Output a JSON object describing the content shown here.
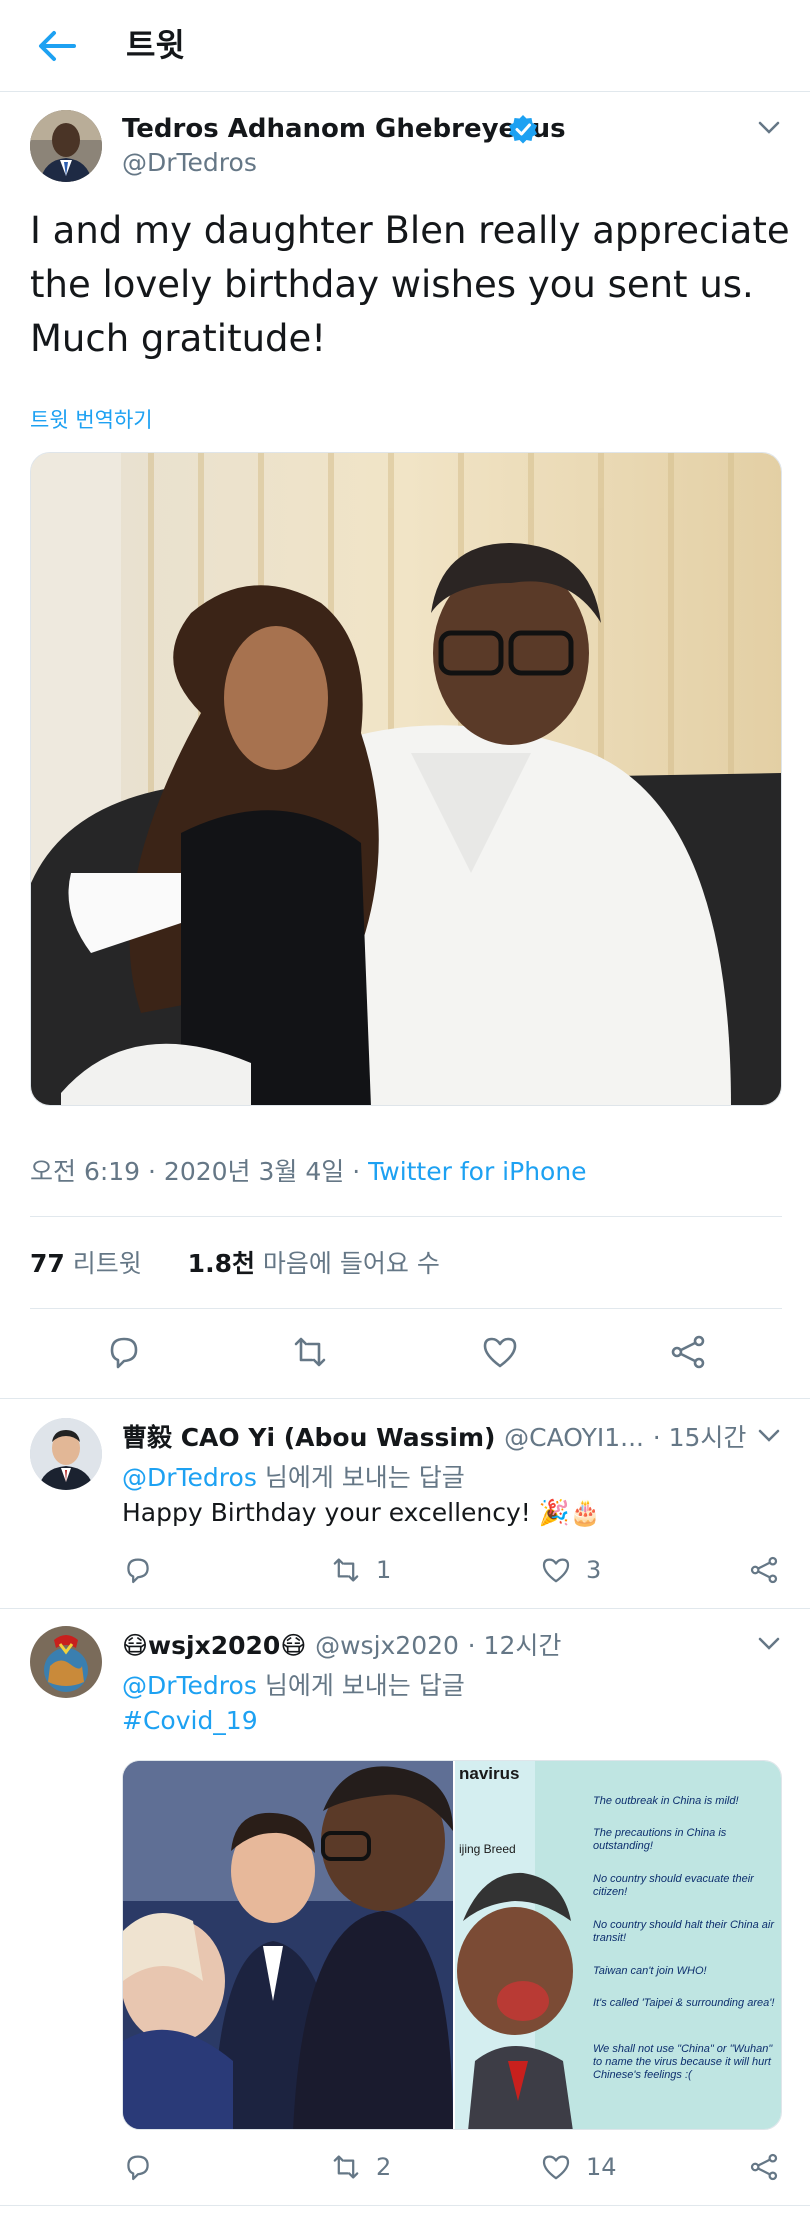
{
  "header": {
    "title": "트윗"
  },
  "tweet": {
    "author_name": "Tedros Adhanom Ghebreyesus",
    "author_handle": "@DrTedros",
    "text": "I and my daughter Blen really appreciate the lovely birthday wishes you sent us. Much gratitude!",
    "translate_label": "트윗 번역하기",
    "time": "오전 6:19 · 2020년 3월 4일 ·",
    "source": "Twitter for iPhone",
    "retweet_count": "77",
    "retweet_label": "리트윗",
    "like_count": "1.8천",
    "like_label": "마음에 들어요 수"
  },
  "replies": [
    {
      "name": "曹毅 CAO Yi (Abou Wassim)",
      "handle": "@CAOYI1...",
      "time": "· 15시간",
      "reply_to_handle": "@DrTedros",
      "reply_to_suffix": "님에게 보내는 답글",
      "text": "Happy Birthday your excellency! 🎉🎂",
      "retweets": "1",
      "likes": "3"
    },
    {
      "name": "😷wsjx2020😷",
      "handle": "@wsjx2020",
      "time": "· 12시간",
      "reply_to_handle": "@DrTedros",
      "reply_to_suffix": "님에게 보내는 답글",
      "hashtag": "#Covid_19",
      "retweets": "2",
      "likes": "14",
      "cartoon": {
        "title_fragment": "navirus",
        "left_label": "ijing Breed",
        "bullets": [
          "The outbreak in China is mild!",
          "The precautions in China is outstanding!",
          "No country should evacuate their citizen!",
          "No country should halt their China air transit!",
          "Taiwan can't join WHO!",
          "It's called 'Taipei & surrounding area'!",
          "We shall not use \"China\" or \"Wuhan\" to name the virus because it will hurt Chinese's feelings :("
        ]
      }
    }
  ],
  "colors": {
    "accent": "#1da1f2",
    "text": "#14171a",
    "muted": "#657786",
    "divider": "#e1e8ed"
  },
  "icons": [
    "back-arrow-icon",
    "verified-badge-icon",
    "chevron-down-icon",
    "reply-icon",
    "retweet-icon",
    "like-icon",
    "share-icon"
  ]
}
